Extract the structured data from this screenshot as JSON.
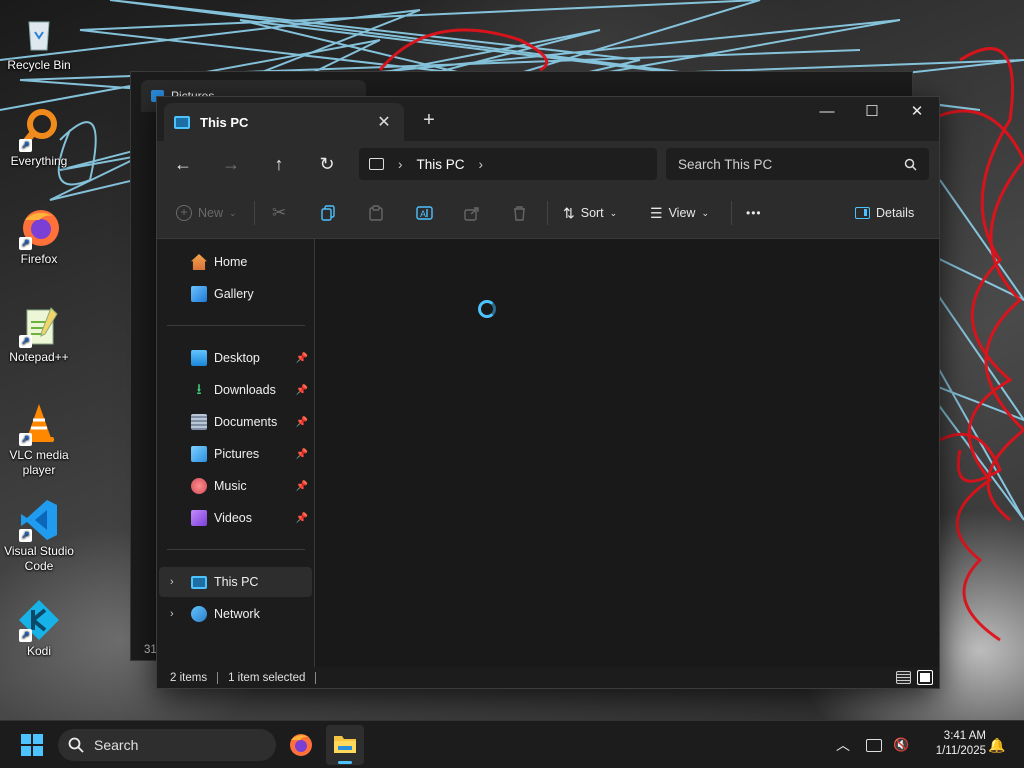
{
  "desktop": {
    "icons": [
      {
        "label": "Recycle Bin"
      },
      {
        "label": "Everything"
      },
      {
        "label": "Firefox"
      },
      {
        "label": "Notepad++"
      },
      {
        "label": "VLC media player"
      },
      {
        "label": "Visual Studio Code"
      },
      {
        "label": "Kodi"
      }
    ]
  },
  "background_window": {
    "tab_label": "Pictures",
    "status_fragment": "31"
  },
  "window": {
    "tab_label": "This PC",
    "tab_close": "✕",
    "new_tab": "+",
    "controls": {
      "minimize": "—",
      "maximize": "☐",
      "close": "✕"
    },
    "address": {
      "segments": [
        "This PC"
      ]
    },
    "search_placeholder": "Search This PC",
    "toolbar": {
      "new_label": "New",
      "sort_label": "Sort",
      "view_label": "View",
      "more_label": "•••",
      "details_label": "Details"
    },
    "sidebar": {
      "top": [
        {
          "label": "Home"
        },
        {
          "label": "Gallery"
        }
      ],
      "quick_access": [
        {
          "label": "Desktop",
          "pinned": true
        },
        {
          "label": "Downloads",
          "pinned": true
        },
        {
          "label": "Documents",
          "pinned": true
        },
        {
          "label": "Pictures",
          "pinned": true
        },
        {
          "label": "Music",
          "pinned": true
        },
        {
          "label": "Videos",
          "pinned": true
        }
      ],
      "tree": [
        {
          "label": "This PC",
          "selected": true
        },
        {
          "label": "Network",
          "selected": false
        }
      ]
    },
    "status": {
      "items": "2 items",
      "selection": "1 item selected"
    }
  },
  "taskbar": {
    "search_label": "Search",
    "time": "3:41 AM",
    "date": "1/11/2025"
  },
  "colors": {
    "accent": "#4cc2ff",
    "window_bg": "#191919",
    "toolbar_bg": "#2c2c2c",
    "taskbar_bg": "#1c1c1c"
  }
}
